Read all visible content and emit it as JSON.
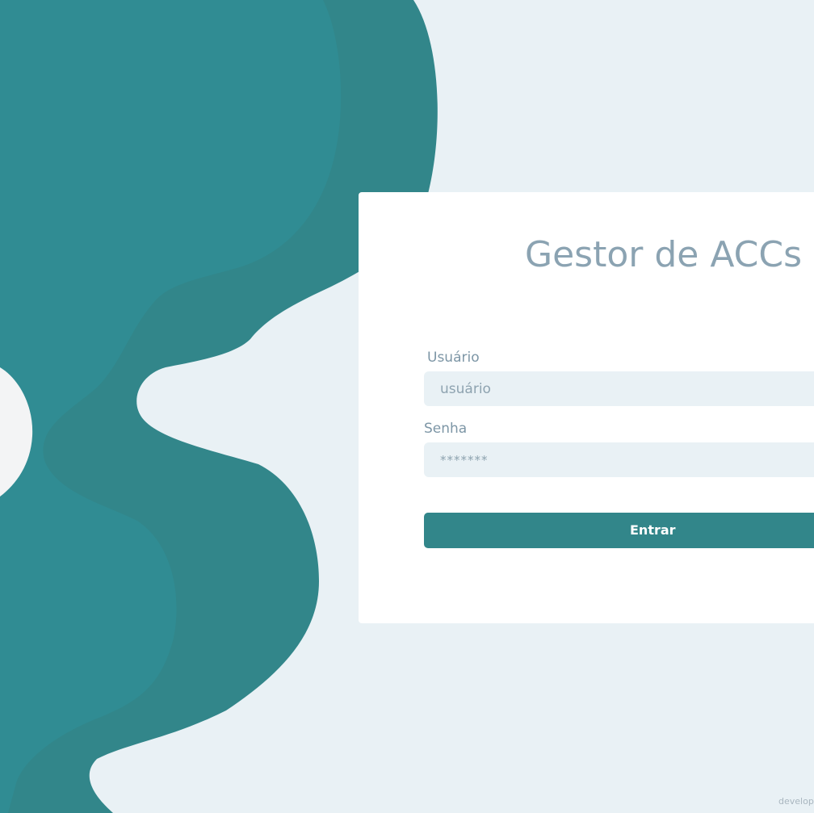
{
  "app": {
    "title": "Gestor de ACCs"
  },
  "form": {
    "username_label": "Usuário",
    "username_placeholder": "usuário",
    "password_label": "Senha",
    "password_placeholder": "*******",
    "submit_label": "Entrar"
  },
  "footer": {
    "credit": "develop"
  },
  "colors": {
    "background": "#e9f1f5",
    "wave_light": "#308c93",
    "wave_dark": "#32868a",
    "card": "#ffffff",
    "title": "#8ba3b2",
    "input_bg": "#e9f1f5",
    "button": "#32868a"
  }
}
